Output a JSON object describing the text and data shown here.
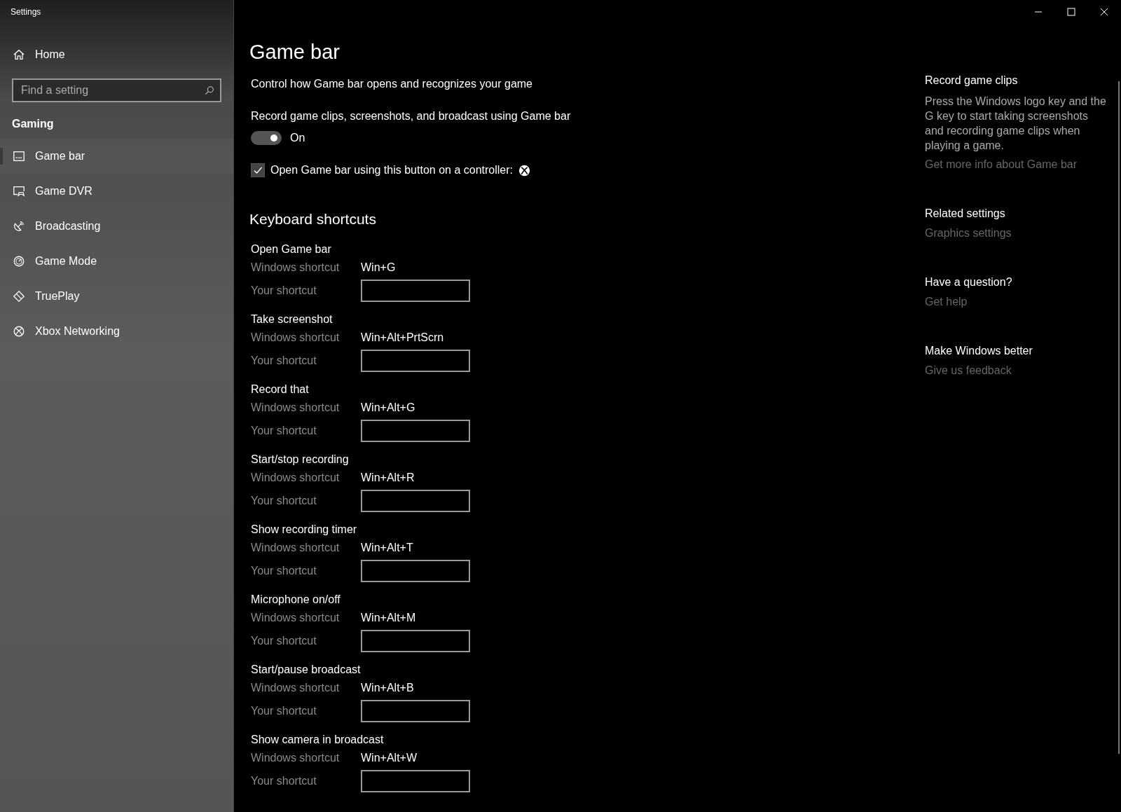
{
  "window": {
    "title": "Settings"
  },
  "sidebar": {
    "home": "Home",
    "search": {
      "placeholder": "Find a setting"
    },
    "section": "Gaming",
    "items": [
      {
        "label": "Game bar",
        "selected": true
      },
      {
        "label": "Game DVR",
        "selected": false
      },
      {
        "label": "Broadcasting",
        "selected": false
      },
      {
        "label": "Game Mode",
        "selected": false
      },
      {
        "label": "TruePlay",
        "selected": false
      },
      {
        "label": "Xbox Networking",
        "selected": false
      }
    ]
  },
  "main": {
    "title": "Game bar",
    "subtitle": "Control how Game bar opens and recognizes your game",
    "toggle": {
      "label": "Record game clips, screenshots, and broadcast using Game bar",
      "on": true,
      "state_text": "On"
    },
    "checkbox": {
      "label": "Open Game bar using this button on a controller:",
      "checked": true
    },
    "shortcuts_title": "Keyboard shortcuts",
    "shortcuts": [
      {
        "name": "Open Game bar",
        "windows_label": "Windows shortcut",
        "windows_value": "Win+G",
        "your_label": "Your shortcut"
      },
      {
        "name": "Take screenshot",
        "windows_label": "Windows shortcut",
        "windows_value": "Win+Alt+PrtScrn",
        "your_label": "Your shortcut"
      },
      {
        "name": "Record that",
        "windows_label": "Windows shortcut",
        "windows_value": "Win+Alt+G",
        "your_label": "Your shortcut"
      },
      {
        "name": "Start/stop recording",
        "windows_label": "Windows shortcut",
        "windows_value": "Win+Alt+R",
        "your_label": "Your shortcut"
      },
      {
        "name": "Show recording timer",
        "windows_label": "Windows shortcut",
        "windows_value": "Win+Alt+T",
        "your_label": "Your shortcut"
      },
      {
        "name": "Microphone on/off",
        "windows_label": "Windows shortcut",
        "windows_value": "Win+Alt+M",
        "your_label": "Your shortcut"
      },
      {
        "name": "Start/pause broadcast",
        "windows_label": "Windows shortcut",
        "windows_value": "Win+Alt+B",
        "your_label": "Your shortcut"
      },
      {
        "name": "Show camera in broadcast",
        "windows_label": "Windows shortcut",
        "windows_value": "Win+Alt+W",
        "your_label": "Your shortcut"
      }
    ]
  },
  "aside": [
    {
      "heading": "Record game clips",
      "text": "Press the Windows logo key and the G key to start taking screenshots and recording game clips when playing a game.",
      "link": "Get more info about Game bar"
    },
    {
      "heading": "Related settings",
      "link": "Graphics settings"
    },
    {
      "heading": "Have a question?",
      "link": "Get help"
    },
    {
      "heading": "Make Windows better",
      "link": "Give us feedback"
    }
  ]
}
